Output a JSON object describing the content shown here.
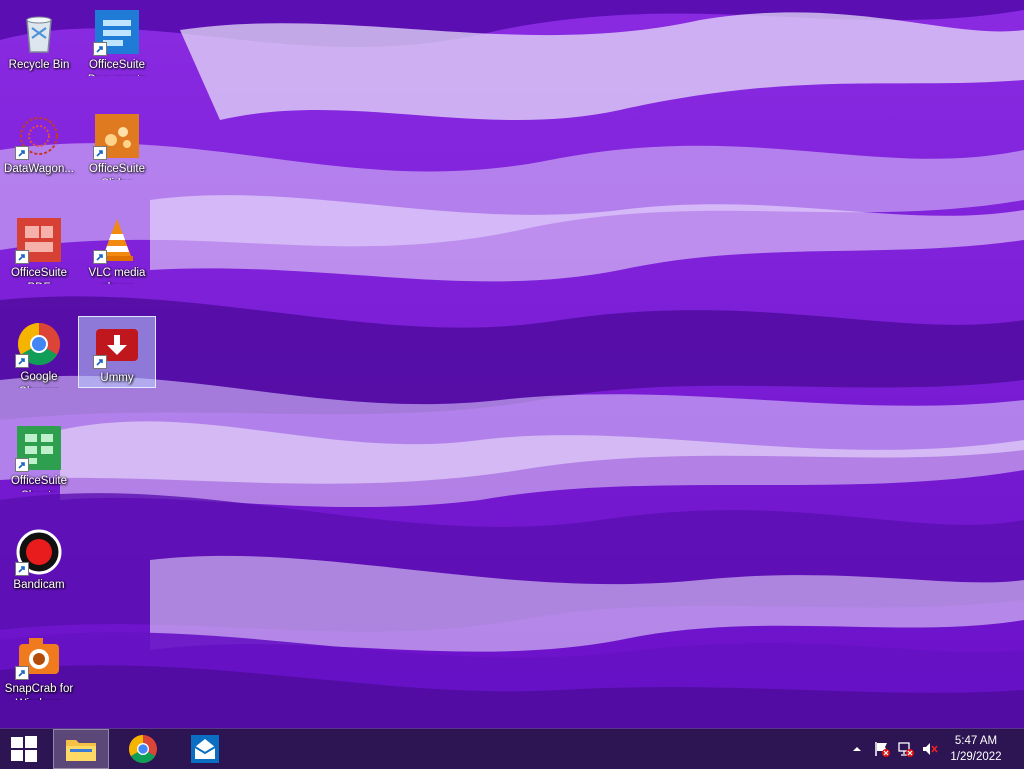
{
  "desktop": {
    "icons": [
      {
        "id": "recycle-bin",
        "label": "Recycle Bin"
      },
      {
        "id": "officesuite-documents",
        "label": "OfficeSuite Documents"
      },
      {
        "id": "datawagon",
        "label": "DataWagon..."
      },
      {
        "id": "officesuite-slides",
        "label": "OfficeSuite Slides"
      },
      {
        "id": "officesuite-pdf",
        "label": "OfficeSuite PDF"
      },
      {
        "id": "vlc",
        "label": "VLC media player"
      },
      {
        "id": "google-chrome",
        "label": "Google Chrome"
      },
      {
        "id": "ummy",
        "label": "Ummy"
      },
      {
        "id": "officesuite-sheets",
        "label": "OfficeSuite Sheets"
      },
      {
        "id": "bandicam",
        "label": "Bandicam"
      },
      {
        "id": "snapcrab",
        "label": "SnapCrab for Windows"
      }
    ]
  },
  "taskbar": {
    "start_icon": "windows-logo",
    "pinned": [
      {
        "name": "file-explorer",
        "icon": "folder-icon",
        "active": true
      },
      {
        "name": "google-chrome",
        "icon": "chrome-icon",
        "active": false
      },
      {
        "name": "mail",
        "icon": "mail-icon",
        "active": false
      }
    ],
    "tray": {
      "icons": [
        "show-hidden-icons-chevron",
        "action-center-flag",
        "network",
        "volume-muted"
      ],
      "time": "5:47 AM",
      "date": "1/29/2022"
    }
  },
  "colors": {
    "accent": "#7a1fe0",
    "taskbar": "#281446"
  }
}
